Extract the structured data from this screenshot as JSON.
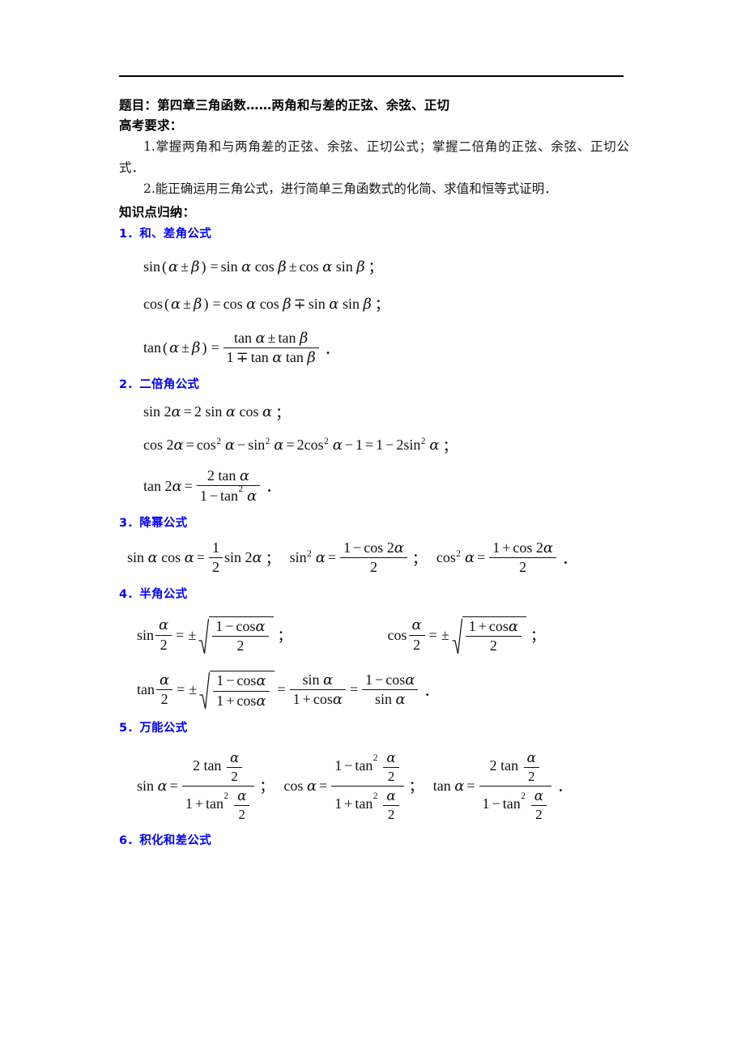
{
  "document": {
    "title_label": "题目：",
    "title_text": "第四章三角函数",
    "title_ellipsis": "……",
    "title_tail": "两角和与差的正弦、余弦、正切",
    "exam_heading": "高考要求：",
    "requirements": [
      "1.掌握两角和与两角差的正弦、余弦、正切公式；掌握二倍角的正弦、余弦、正切公式．",
      "2.能正确运用三角公式，进行简单三角函数式的化简、求值和恒等式证明．"
    ],
    "knowledge_heading": "知识点归纳："
  },
  "sections": [
    {
      "number": "1．",
      "label": "和、差角公式"
    },
    {
      "number": "2．",
      "label": "二倍角公式"
    },
    {
      "number": "3．",
      "label": "降幂公式"
    },
    {
      "number": "4．",
      "label": "半角公式"
    },
    {
      "number": "5．",
      "label": "万能公式"
    },
    {
      "number": "6．",
      "label": "积化和差公式"
    }
  ],
  "symbols": {
    "alpha": "α",
    "beta": "β",
    "plus_minus": "±",
    "minus_plus": "∓",
    "equals": "=",
    "plus": "+",
    "minus": "−",
    "semicolon": "；",
    "period": "．",
    "one": "1",
    "two": "2",
    "sin": "sin",
    "cos": "cos",
    "tan": "tan",
    "lparen": "(",
    "rparen": ")",
    "sup2": "2"
  },
  "formulas": {
    "sin_sum": "sin(α ± β) = sin α cos β ± cos α sin β ；",
    "cos_sum": "cos(α ± β) = cos α cos β ∓ sin α sin β ；",
    "tan_sum": "tan(α ± β) = (tan α ± tan β) / (1 ∓ tan α tan β)．",
    "sin_double": "sin 2α = 2 sin α cos α ；",
    "cos_double": "cos 2α = cos²α − sin²α = 2cos²α − 1 = 1 − 2sin²α ；",
    "tan_double": "tan 2α = 2 tan α / (1 − tan²α)．",
    "power_sincos": "sin α cos α = (1/2) sin 2α ；",
    "power_sin2": "sin²α = (1 − cos 2α)/2 ；",
    "power_cos2": "cos²α = (1 + cos 2α)/2 ．",
    "half_sin": "sin(α/2) = ±√((1 − cos α)/2) ；",
    "half_cos": "cos(α/2) = ±√((1 + cos α)/2) ；",
    "half_tan": "tan(α/2) = ±√((1 − cos α)/(1 + cos α)) = sin α/(1 + cos α) = (1 − cos α)/sin α ．",
    "univ_sin": "sin α = 2tan(α/2) / (1 + tan²(α/2)) ；",
    "univ_cos": "cos α = (1 − tan²(α/2)) / (1 + tan²(α/2)) ；",
    "univ_tan": "tan α = 2tan(α/2) / (1 − tan²(α/2)) ．"
  },
  "colors": {
    "heading_blue": "#0000ff",
    "text_black": "#000000",
    "rule": "#000000",
    "background": "#ffffff"
  }
}
